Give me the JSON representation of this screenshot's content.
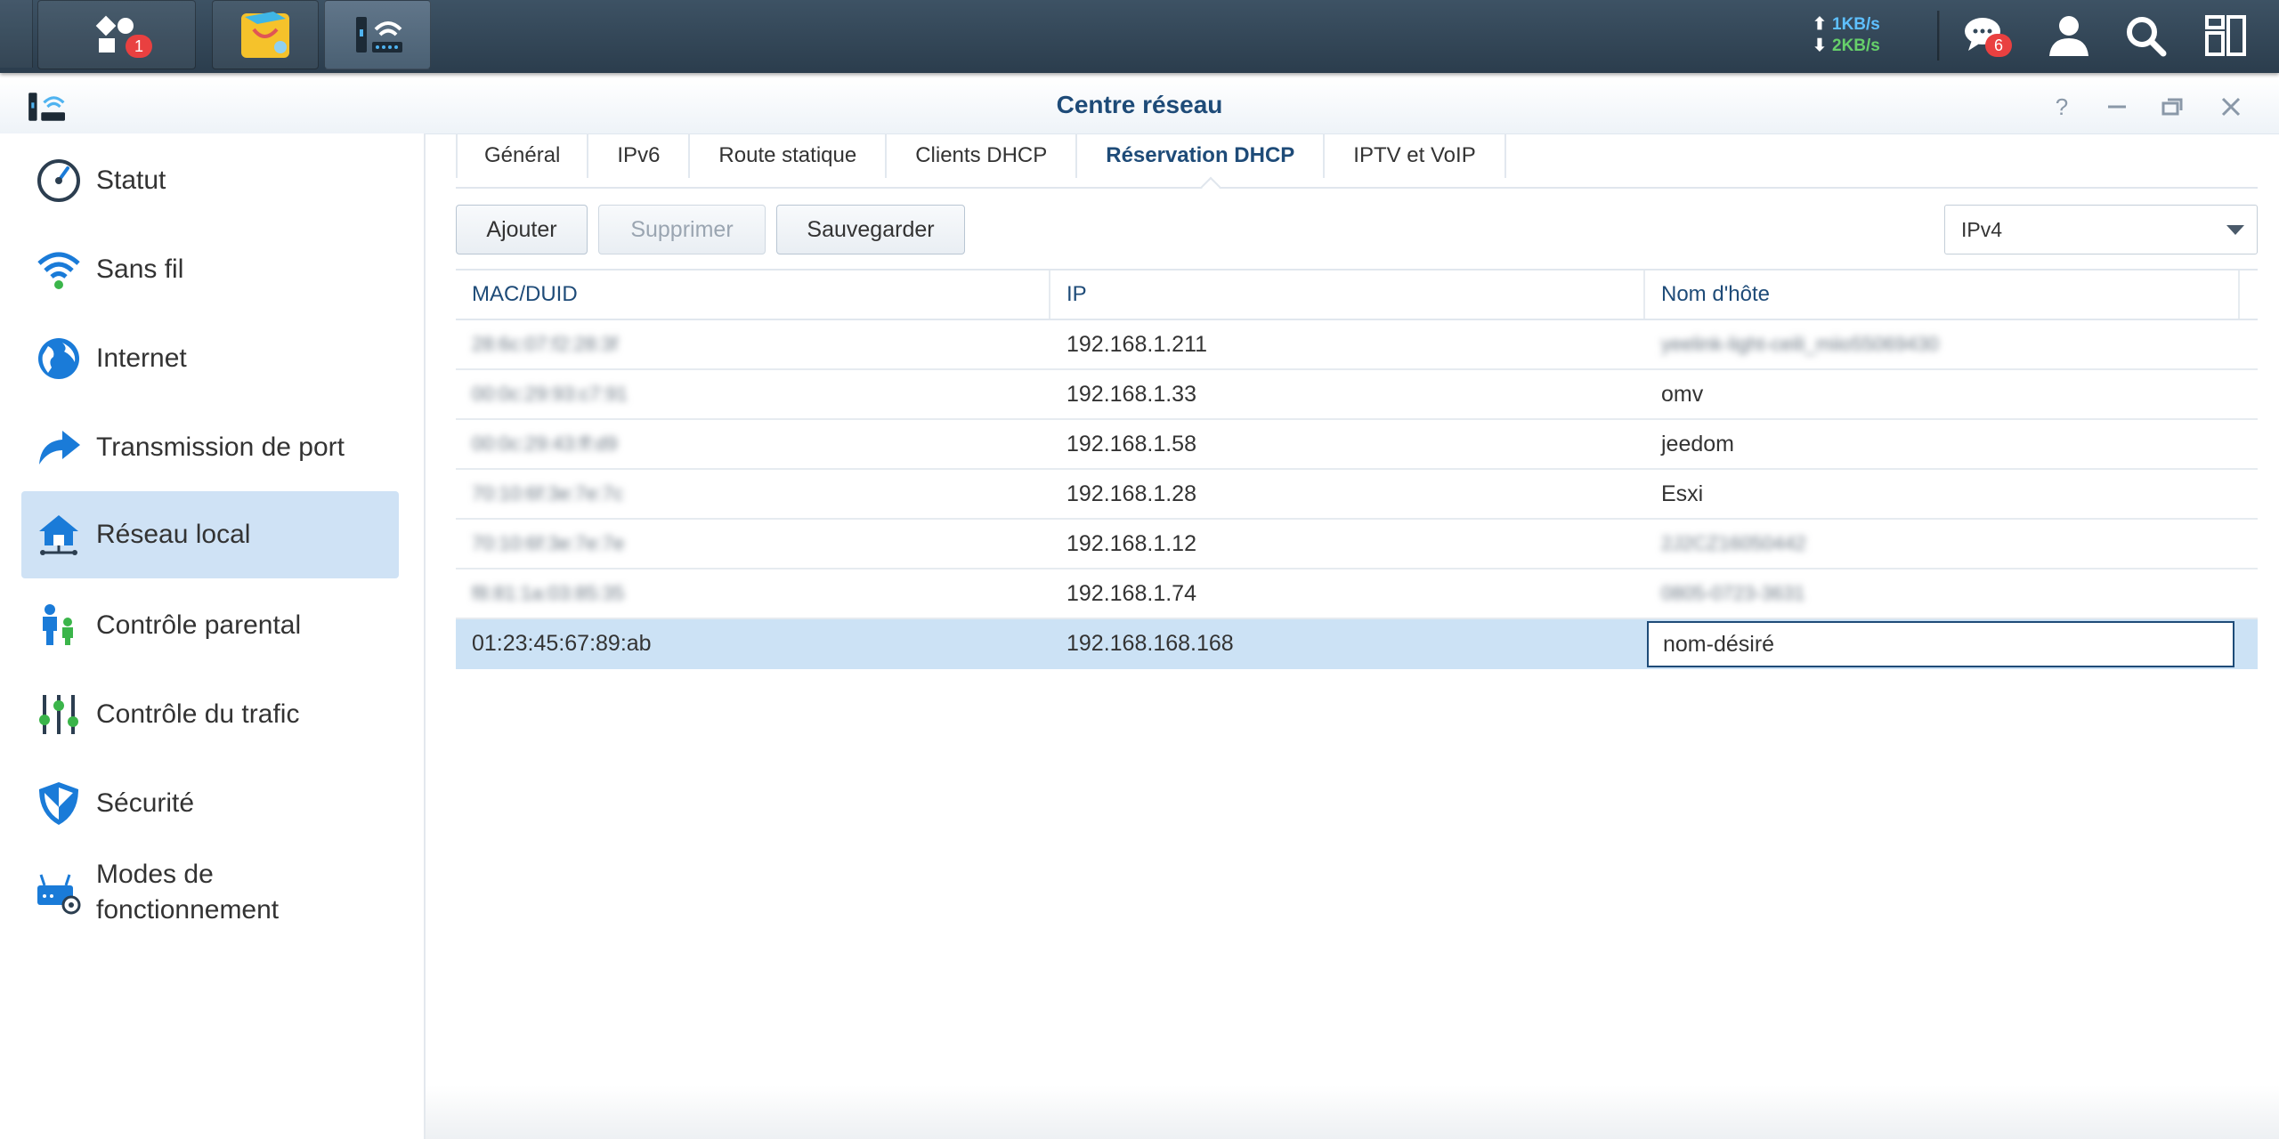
{
  "taskbar": {
    "main_menu_badge": "1",
    "upload_speed": "1KB/s",
    "download_speed": "2KB/s",
    "notifications_badge": "6",
    "colors": {
      "background": "#34495a",
      "badge": "#e94040",
      "upload": "#5ec0ff",
      "download": "#66d06a"
    }
  },
  "window": {
    "title": "Centre réseau",
    "accent": "#1e4b78"
  },
  "sidebar": {
    "items": [
      {
        "label": "Statut",
        "icon": "gauge-icon"
      },
      {
        "label": "Sans fil",
        "icon": "wifi-icon"
      },
      {
        "label": "Internet",
        "icon": "globe-icon"
      },
      {
        "label": "Transmission de port",
        "icon": "forward-arrow-icon"
      },
      {
        "label": "Réseau local",
        "icon": "home-network-icon",
        "active": true
      },
      {
        "label": "Contrôle parental",
        "icon": "family-icon"
      },
      {
        "label": "Contrôle du trafic",
        "icon": "sliders-icon"
      },
      {
        "label": "Sécurité",
        "icon": "shield-icon"
      },
      {
        "label": "Modes de fonctionnement",
        "icon": "router-gear-icon"
      }
    ]
  },
  "tabs": [
    "Général",
    "IPv6",
    "Route statique",
    "Clients DHCP",
    "Réservation DHCP",
    "IPTV et VoIP"
  ],
  "active_tab": "Réservation DHCP",
  "toolbar": {
    "add_label": "Ajouter",
    "delete_label": "Supprimer",
    "save_label": "Sauvegarder",
    "ip_version": "IPv4"
  },
  "table": {
    "columns": [
      "MAC/DUID",
      "IP",
      "Nom d'hôte"
    ],
    "rows": [
      {
        "mac": "28:6c:07:f2:28:3f",
        "ip": "192.168.1.211",
        "host": "yeelink-light-ceili_miio55069430",
        "mac_blurred": true,
        "host_blurred": true
      },
      {
        "mac": "00:0c:29:93:c7:91",
        "ip": "192.168.1.33",
        "host": "omv",
        "mac_blurred": true
      },
      {
        "mac": "00:0c:29:43:ff:d9",
        "ip": "192.168.1.58",
        "host": "jeedom",
        "mac_blurred": true
      },
      {
        "mac": "70:10:6f:3e:7e:7c",
        "ip": "192.168.1.28",
        "host": "Esxi",
        "mac_blurred": true
      },
      {
        "mac": "70:10:6f:3e:7e:7e",
        "ip": "192.168.1.12",
        "host": "2J2CZ16050442",
        "mac_blurred": true,
        "host_blurred": true
      },
      {
        "mac": "f8:81:1a:03:85:35",
        "ip": "192.168.1.74",
        "host": "0805-0723-3631",
        "mac_blurred": true,
        "host_blurred": true
      },
      {
        "mac": "01:23:45:67:89:ab",
        "ip": "192.168.168.168",
        "host": "nom-désiré",
        "selected": true
      }
    ]
  }
}
